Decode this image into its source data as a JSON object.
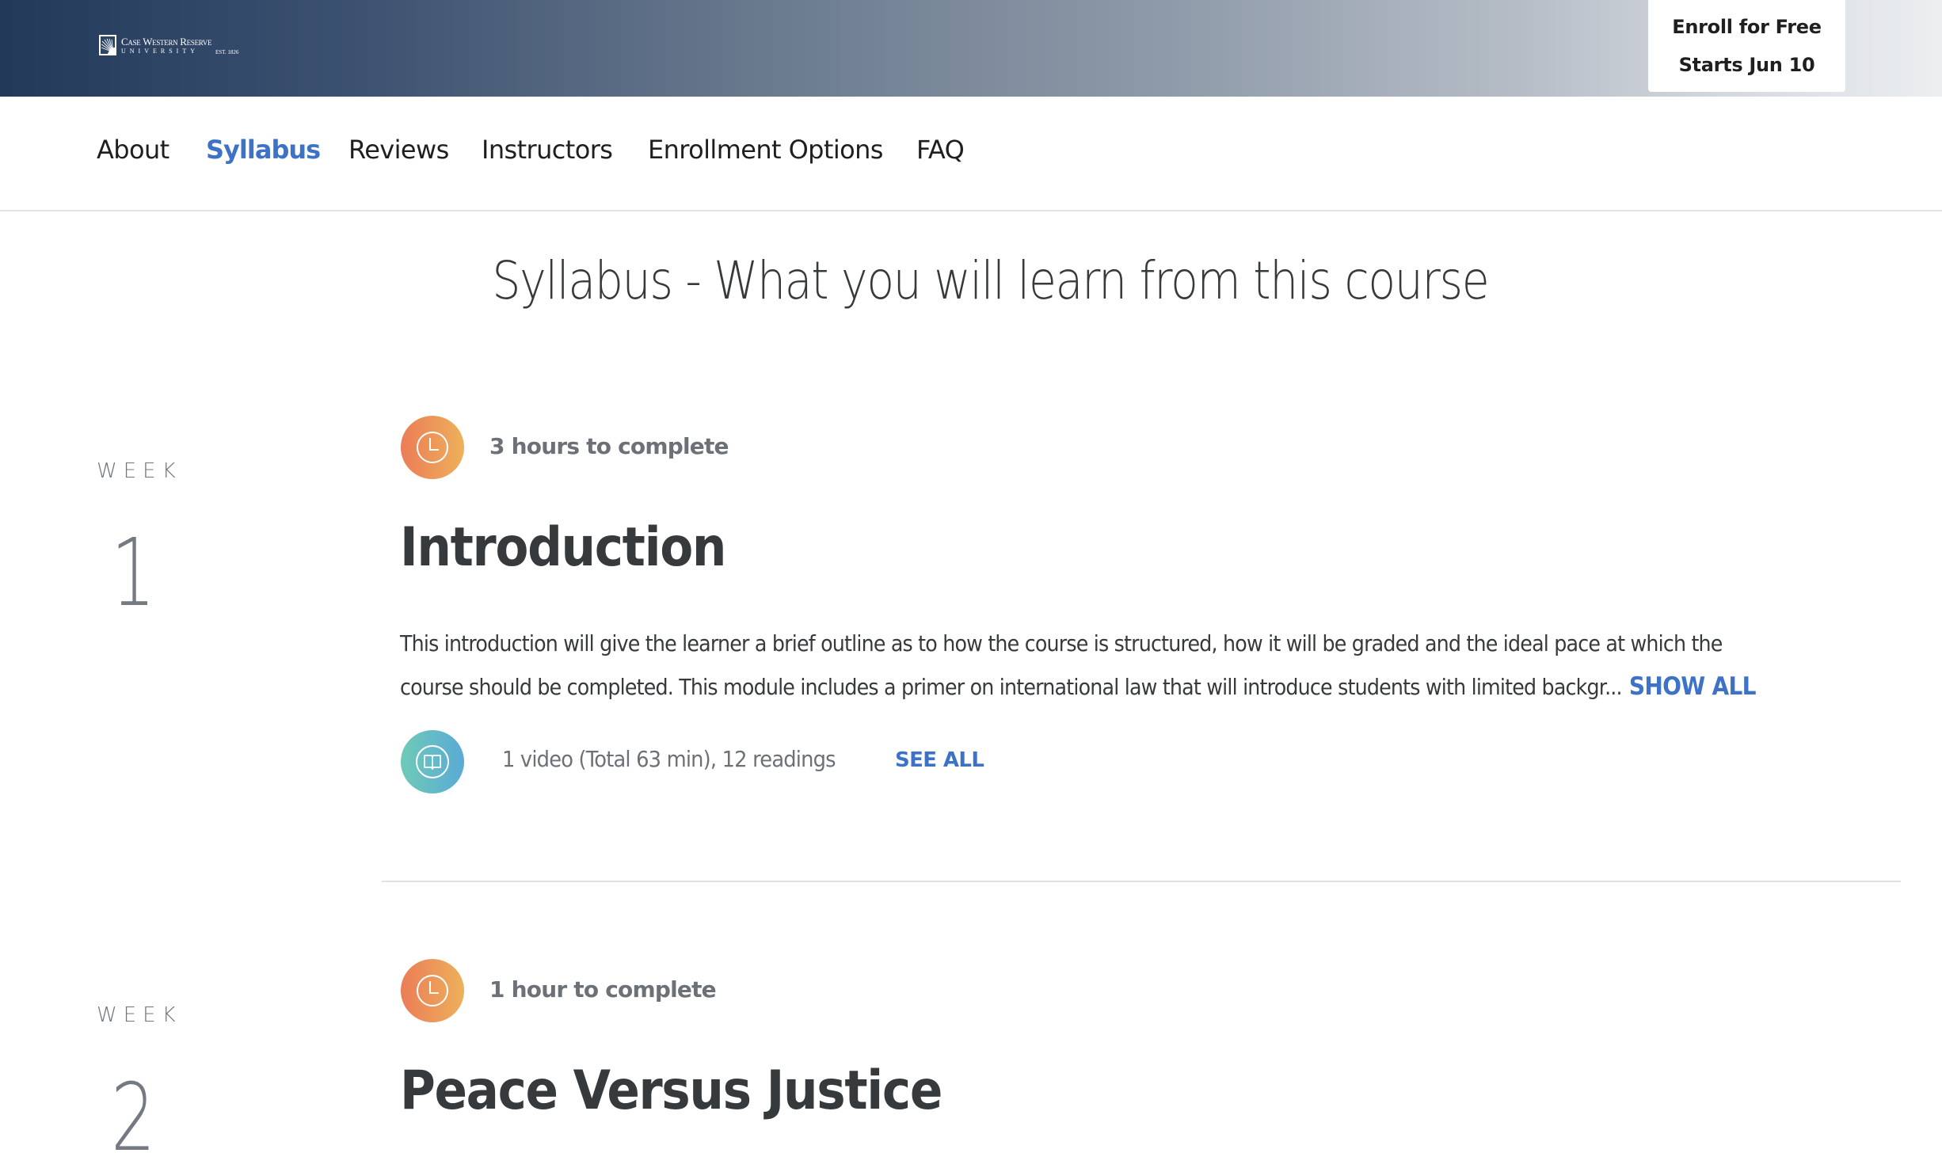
{
  "header": {
    "logo": {
      "name": "Case Western Reserve",
      "subtitle": "UNIVERSITY",
      "established": "EST. 1826"
    },
    "enroll_button": {
      "line1": "Enroll for Free",
      "line2": "Starts Jun 10"
    }
  },
  "nav": {
    "items": [
      {
        "label": "About",
        "active": false
      },
      {
        "label": "Syllabus",
        "active": true
      },
      {
        "label": "Reviews",
        "active": false
      },
      {
        "label": "Instructors",
        "active": false
      },
      {
        "label": "Enrollment Options",
        "active": false
      },
      {
        "label": "FAQ",
        "active": false
      }
    ]
  },
  "page_title": "Syllabus - What you will learn from this course",
  "weeks": [
    {
      "week_label": "WEEK",
      "number": "1",
      "time_icon": "clock-icon",
      "time_to_complete": "3 hours to complete",
      "title": "Introduction",
      "description_lines": [
        "This introduction will give the learner a brief outline as to how the course is structured, how it will be graded and the ideal pace at which the",
        "course should be completed. This module includes a primer on international law that will introduce students with limited backgr..."
      ],
      "show_all_label": "SHOW ALL",
      "content_icon": "book-icon",
      "content_summary": "1 video (Total 63 min), 12 readings",
      "see_all_label": "SEE ALL"
    },
    {
      "week_label": "WEEK",
      "number": "2",
      "time_icon": "clock-icon",
      "time_to_complete": "1 hour to complete",
      "title": "Peace Versus Justice"
    }
  ],
  "colors": {
    "accent_blue": "#3d72c6",
    "header_gradient_start": "#22395a",
    "header_gradient_end": "#eceef0",
    "clock_gradient": [
      "#ec7c58",
      "#edb15a"
    ],
    "book_gradient": [
      "#6fcab6",
      "#5aaad6"
    ]
  }
}
